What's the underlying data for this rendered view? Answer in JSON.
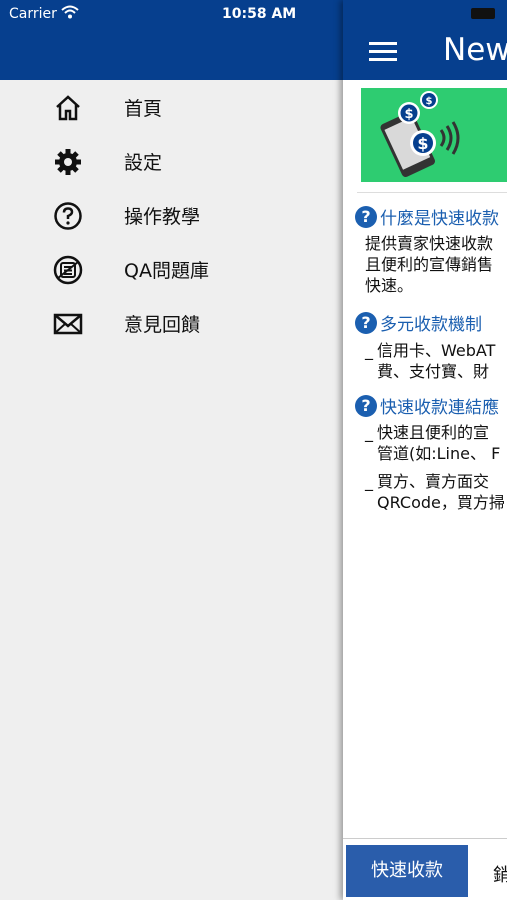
{
  "status_bar": {
    "carrier": "Carrier",
    "time": "10:58 AM"
  },
  "drawer": {
    "items": [
      {
        "label": "首頁",
        "icon": "home-icon"
      },
      {
        "label": "設定",
        "icon": "gear-icon"
      },
      {
        "label": "操作教學",
        "icon": "help-circle-icon"
      },
      {
        "label": "QA問題庫",
        "icon": "qa-list-icon"
      },
      {
        "label": "意見回饋",
        "icon": "mail-icon"
      }
    ]
  },
  "main": {
    "title": "New",
    "sections": [
      {
        "title": "什麼是快速收款",
        "lines": [
          "提供賣家快速收款",
          "且便利的宣傳銷售",
          "快速。"
        ]
      },
      {
        "title": "多元收款機制",
        "bullets": [
          [
            "信用卡、WebAT",
            "費、支付寶、財"
          ]
        ]
      },
      {
        "title": "快速收款連結應",
        "bullets": [
          [
            "快速且便利的宣",
            "管道(如:Line、 F"
          ],
          [
            "買方、賣方面交",
            "QRCode，買方掃"
          ]
        ]
      }
    ],
    "tabs": [
      {
        "label": "快速收款",
        "active": true
      },
      {
        "label": "銷"
      }
    ]
  },
  "colors": {
    "header": "#063f8e",
    "accent": "#1b5fb0",
    "banner": "#2ecc71"
  }
}
